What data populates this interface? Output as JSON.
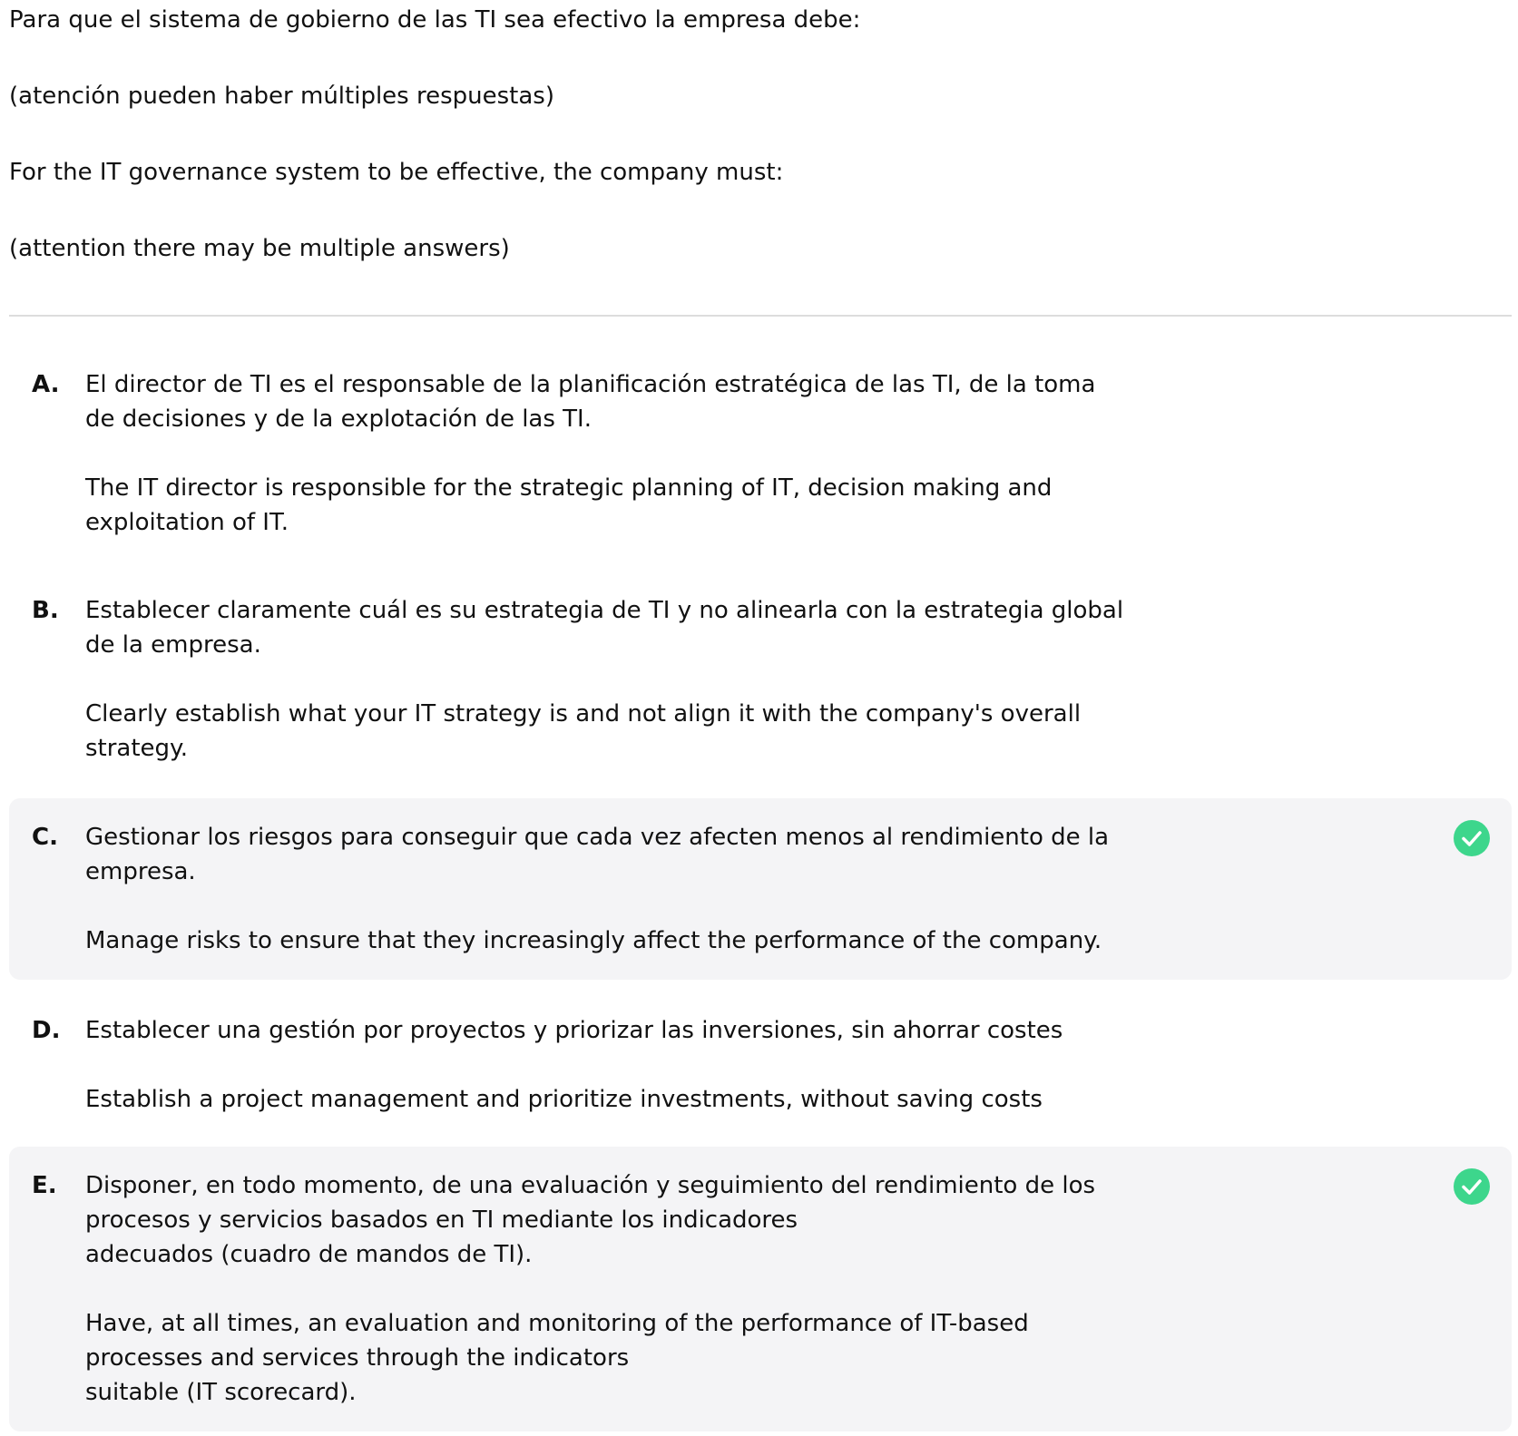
{
  "question": {
    "lines": [
      "Para que el sistema de gobierno de las TI sea efectivo la empresa debe:",
      "(atención pueden haber múltiples respuestas)",
      "For the IT governance system to be effective, the company must:",
      "(attention there may be multiple answers)"
    ]
  },
  "options": [
    {
      "letter": "A.",
      "selected": false,
      "spanish": [
        "El director de TI es el responsable de la planificación estratégica de las TI, de la toma",
        "de decisiones y de la explotación de las TI."
      ],
      "english": [
        "The IT director is responsible for the strategic planning of IT, decision making and",
        "exploitation of IT."
      ]
    },
    {
      "letter": "B.",
      "selected": false,
      "spanish": [
        "Establecer claramente cuál es su estrategia de TI y no alinearla con la estrategia global",
        "de la empresa."
      ],
      "english": [
        "Clearly establish what your IT strategy is and not align it with the company's overall",
        "strategy."
      ]
    },
    {
      "letter": "C.",
      "selected": true,
      "spanish": [
        "Gestionar los riesgos para conseguir que cada vez afecten menos al rendimiento de la",
        "empresa."
      ],
      "english": [
        "Manage risks to ensure that they increasingly affect the performance of the company."
      ]
    },
    {
      "letter": "D.",
      "selected": false,
      "spanish": [
        "Establecer una gestión por proyectos y priorizar las inversiones, sin ahorrar costes"
      ],
      "english": [
        "Establish a project management and prioritize investments, without saving costs"
      ]
    },
    {
      "letter": "E.",
      "selected": true,
      "spanish": [
        "Disponer, en todo momento, de una evaluación y seguimiento del rendimiento de los",
        "procesos y servicios basados en TI mediante los indicadores",
        "adecuados (cuadro de mandos de TI)."
      ],
      "english": [
        "Have, at all times, an evaluation and monitoring of the performance of IT-based",
        "processes and services through the indicators",
        "suitable (IT scorecard)."
      ]
    }
  ],
  "colors": {
    "text": "#111111",
    "selected_background": "#f4f4f6",
    "check_green": "#3dd68c",
    "divider": "#dddddd"
  },
  "icons": {
    "selected_marker": "check-circle-icon"
  }
}
